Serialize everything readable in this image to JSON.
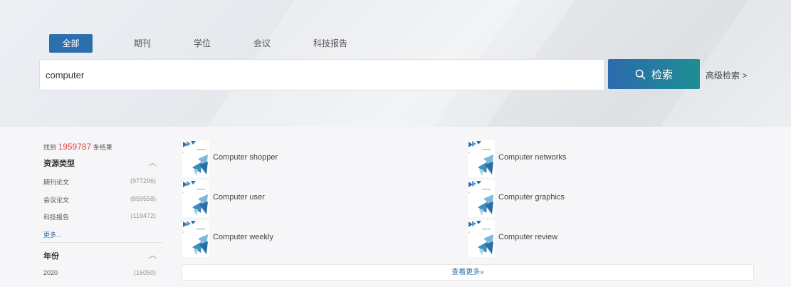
{
  "tabs": [
    {
      "label": "全部",
      "active": true
    },
    {
      "label": "期刊",
      "active": false
    },
    {
      "label": "学位",
      "active": false
    },
    {
      "label": "会议",
      "active": false
    },
    {
      "label": "科技报告",
      "active": false
    }
  ],
  "search": {
    "value": "computer",
    "button_label": "检索",
    "advanced_label": "高级检索 >"
  },
  "results": {
    "prefix": "找到",
    "count": "1959787",
    "suffix": "条结果"
  },
  "facets": {
    "resource_type": {
      "title": "资源类型",
      "items": [
        {
          "label": "期刊论文",
          "count": "(977296)"
        },
        {
          "label": "会议论文",
          "count": "(859558)"
        },
        {
          "label": "科技报告",
          "count": "(119472)"
        }
      ],
      "more": "更多..."
    },
    "year": {
      "title": "年份",
      "items": [
        {
          "label": "2020",
          "count": "(16050)"
        }
      ]
    }
  },
  "journals": [
    {
      "title": "Computer shopper"
    },
    {
      "title": "Computer networks"
    },
    {
      "title": "Computer user"
    },
    {
      "title": "Computer graphics"
    },
    {
      "title": "Computer weekly"
    },
    {
      "title": "Computer review"
    }
  ],
  "view_more": "查看更多»",
  "colors": {
    "primary": "#2d6fad",
    "button_gradient_end": "#1e8e92",
    "highlight": "#e04a4a"
  }
}
